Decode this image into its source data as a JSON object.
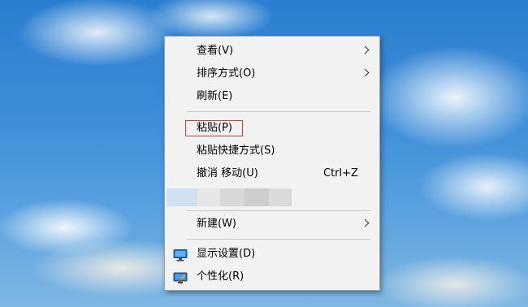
{
  "context_menu": {
    "items": [
      {
        "label": "查看(V)",
        "has_submenu": true
      },
      {
        "label": "排序方式(O)",
        "has_submenu": true
      },
      {
        "label": "刷新(E)"
      },
      {
        "label": "粘贴(P)",
        "highlighted": true
      },
      {
        "label": "粘贴快捷方式(S)"
      },
      {
        "label": "撤消 移动(U)",
        "shortcut": "Ctrl+Z"
      },
      {
        "label": "新建(W)",
        "has_submenu": true
      },
      {
        "label": "显示设置(D)",
        "icon": "display-settings-icon"
      },
      {
        "label": "个性化(R)",
        "icon": "personalize-icon"
      }
    ]
  },
  "colors": {
    "menu_background": "#f2f2f2",
    "highlight_border": "#d33a3a",
    "sky": "#2b7ed0"
  }
}
